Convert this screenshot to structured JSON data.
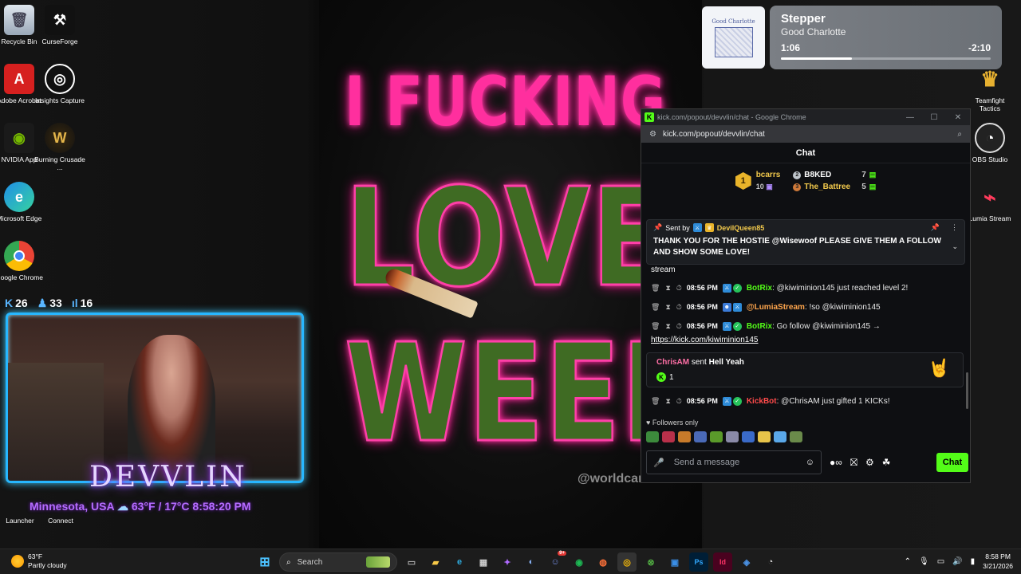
{
  "desktop_icons": [
    {
      "label": "Recycle Bin",
      "icon": "recycle-bin-icon"
    },
    {
      "label": "CurseForge",
      "icon": "curseforge-icon"
    },
    {
      "label": "Adobe Acrobat",
      "icon": "acrobat-icon"
    },
    {
      "label": "Insights Capture",
      "icon": "insights-capture-icon"
    },
    {
      "label": "NVIDIA App",
      "icon": "nvidia-icon"
    },
    {
      "label": "Burning Crusade ...",
      "icon": "wow-icon"
    },
    {
      "label": "Microsoft Edge",
      "icon": "edge-icon"
    },
    {
      "label": "Google Chrome",
      "icon": "chrome-icon"
    },
    {
      "label": "Teamfight Tactics",
      "icon": "tft-icon"
    },
    {
      "label": "OBS Studio",
      "icon": "obs-icon"
    },
    {
      "label": "Lumia Stream",
      "icon": "lumia-icon"
    },
    {
      "label": "Launcher",
      "icon": "launcher-icon"
    },
    {
      "label": "Connect",
      "icon": "connect-icon"
    }
  ],
  "wallpaper": {
    "line1": "I FUCKING",
    "line2": "LOVE",
    "line3": "WEED",
    "watermark": "@worldcanna"
  },
  "overlay": {
    "stat1": "26",
    "stat2": "33",
    "stat3": "16",
    "name": "DEVVLIN",
    "location": "Minnesota, USA",
    "temp": "63°F / 17°C",
    "time": "8:58:20 PM"
  },
  "media": {
    "song": "Stepper",
    "artist": "Good Charlotte",
    "album_text": "Good Charlotte",
    "elapsed": "1:06",
    "remaining": "-2:10",
    "progress": 0.34
  },
  "browser": {
    "title": "kick.com/popout/devvlin/chat - Google Chrome",
    "url": "kick.com/popout/devvlin/chat"
  },
  "chat": {
    "header": "Chat",
    "leaderboard": {
      "first_name": "bcarrs",
      "first_rank": "1",
      "first_subs": "10",
      "second_name": "B8KED",
      "second_count": "7",
      "third_name": "The_Battree",
      "third_count": "5"
    },
    "pinned": {
      "sent_by_label": "Sent by",
      "user": "DevilQueen85",
      "text": "THANK YOU FOR THE HOSTIE @Wisewoof PLEASE GIVE THEM A FOLLOW AND SHOW SOME LOVE!"
    },
    "partial_line": "stream",
    "messages": [
      {
        "time": "08:56 PM",
        "user": "BotRix",
        "text": ": @kiwiminion145 just reached level 2!"
      },
      {
        "time": "08:56 PM",
        "user": "@LumiaStream",
        "text": ": !so @kiwiminion145"
      },
      {
        "time": "08:56 PM",
        "user": "BotRix",
        "text": ": Go follow @kiwiminion145 →"
      }
    ],
    "link": "https://kick.com/kiwiminion145",
    "gift": {
      "user": "ChrisAM",
      "sent": "sent",
      "item": "Hell Yeah",
      "count": "1"
    },
    "last_message": {
      "time": "08:56 PM",
      "user": "KickBot",
      "text": ": @ChrisAM just gifted 1 KICKs!"
    },
    "followers_only": "Followers only",
    "input_placeholder": "Send a message",
    "send_button": "Chat"
  },
  "taskbar": {
    "weather_temp": "63°F",
    "weather_desc": "Partly cloudy",
    "search_placeholder": "Search",
    "badge_count": "9+",
    "clock_time": "8:58 PM",
    "clock_date": "3/21/2026"
  }
}
